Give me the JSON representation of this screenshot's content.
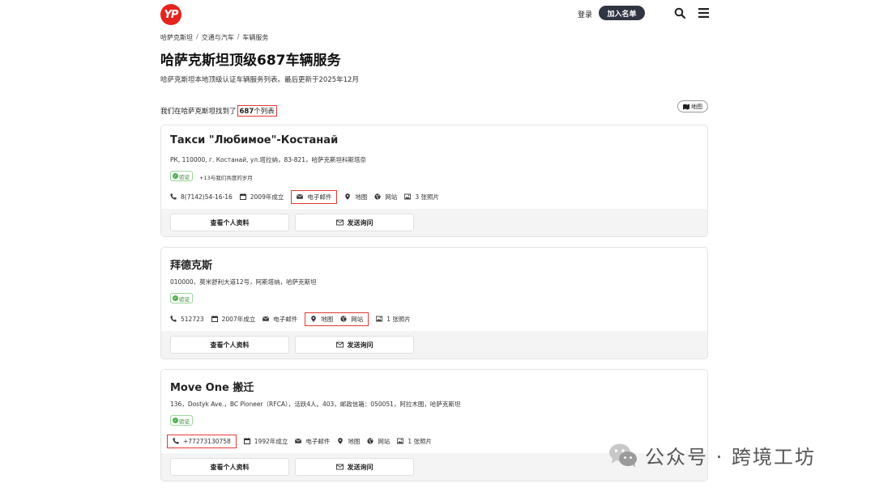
{
  "header": {
    "logo_text": "YP",
    "login_label": "登录",
    "join_label": "加入名单"
  },
  "breadcrumb": [
    "哈萨克斯坦",
    "交通与汽车",
    "车辆服务"
  ],
  "page": {
    "title": "哈萨克斯坦顶级687车辆服务",
    "description": "哈萨克斯坦本地顶级认证车辆服务列表。最后更新于2025年12月",
    "found_prefix": "我们在哈萨克斯坦找到了",
    "found_count": "687",
    "found_suffix": "个列表",
    "map_button": "地图"
  },
  "listings": [
    {
      "name": "Такси \"Любимое\"-Костанай",
      "address": "РК, 110000, г. Костанай, ул.塔拉纳，83-821，哈萨克斯坦科斯塔奈",
      "verified": "验证",
      "years": "+13与我们共度的岁月",
      "phone": "8(7142)54-16-16",
      "founded": "2009年成立",
      "email": "电子邮件",
      "map": "地图",
      "website": "网站",
      "photos": "3 张照片",
      "profile_button": "查看个人资料",
      "inquiry_button": "发送询问"
    },
    {
      "name": "拜德克斯",
      "address": "010000，莫米舒利大道12号，阿斯塔纳，哈萨克斯坦",
      "verified": "验证",
      "phone": "512723",
      "founded": "2007年成立",
      "email": "电子邮件",
      "map": "地图",
      "website": "网站",
      "photos": "1 张照片",
      "profile_button": "查看个人资料",
      "inquiry_button": "发送询问"
    },
    {
      "name": "Move One 搬迁",
      "address": "136，Dostyk Ave.，BC Pioneer（RFCA），活跃4人。403，邮政信箱：050051，阿拉木图，哈萨克斯坦",
      "verified": "验证",
      "phone": "+77273130758",
      "founded": "1992年成立",
      "email": "电子邮件",
      "map": "地图",
      "website": "网站",
      "photos": "1 张照片",
      "profile_button": "查看个人资料",
      "inquiry_button": "发送询问"
    }
  ],
  "watermark": {
    "text": "公众号 · 跨境工坊"
  },
  "colors": {
    "brand_red": "#e4241d",
    "dark_button": "#2f3542",
    "highlight_border": "#e53935",
    "verified_green": "#4caf50"
  },
  "icons": [
    "search-icon",
    "menu-icon",
    "phone-icon",
    "calendar-icon",
    "envelope-icon",
    "map-pin-icon",
    "globe-icon",
    "image-icon",
    "check-icon",
    "wechat-icon"
  ]
}
